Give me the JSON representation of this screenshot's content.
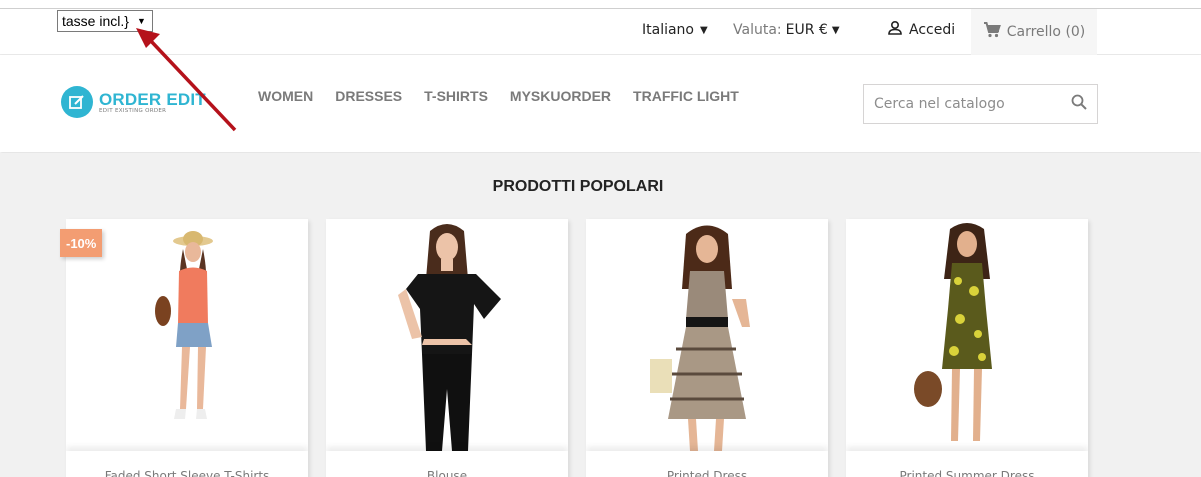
{
  "topnav": {
    "tax_select": "tasse incl.}",
    "language": "Italiano",
    "currency_label": "Valuta:",
    "currency_value": "EUR €",
    "login": "Accedi",
    "cart": "Carrello (0)"
  },
  "header": {
    "logo_title": "ORDER EDIT",
    "logo_subtitle": "EDIT EXISTING ORDER",
    "menu": [
      "WOMEN",
      "DRESSES",
      "T-SHIRTS",
      "MYSKUORDER",
      "TRAFFIC LIGHT"
    ],
    "search_placeholder": "Cerca nel catalogo"
  },
  "main": {
    "section_title": "PRODOTTI POPOLARI",
    "products": [
      {
        "name": "Faded Short Sleeve T-Shirts",
        "badge": "-10%"
      },
      {
        "name": "Blouse"
      },
      {
        "name": "Printed Dress"
      },
      {
        "name": "Printed Summer Dress"
      }
    ]
  },
  "colors": {
    "accent": "#2fb5d2",
    "discount_badge": "#f39d72",
    "annotation_arrow": "#b5121b",
    "background_main": "#f1f1f1"
  }
}
